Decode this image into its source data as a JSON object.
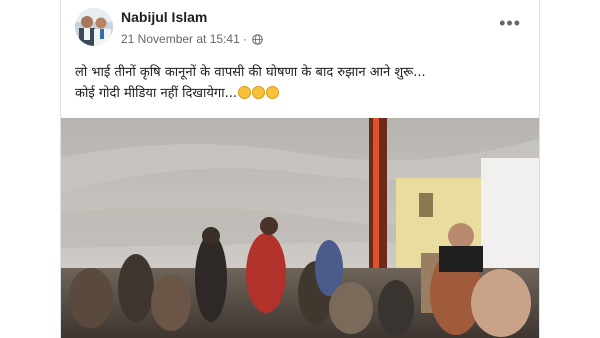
{
  "post": {
    "author": "Nabijul Islam",
    "date": "21 November at 15:41",
    "separator": "·",
    "privacy_icon": "globe-icon",
    "more_icon": "more-options-icon",
    "more_label": "•••",
    "text_line1": "लो भाई तीनों कृषि कानूनों के वापसी की घोषणा के बाद रुझान आने शुरू...",
    "text_line2": "कोई गोदी मीडिया नहीं दिखायेगा...",
    "emojis": [
      "laughing-emoji",
      "rolling-on-floor-laughing-emoji",
      "laughing-emoji"
    ],
    "media_type": "video"
  },
  "colors": {
    "text": "#1c1e21",
    "secondary": "#65676b",
    "border": "#dddfe2"
  }
}
